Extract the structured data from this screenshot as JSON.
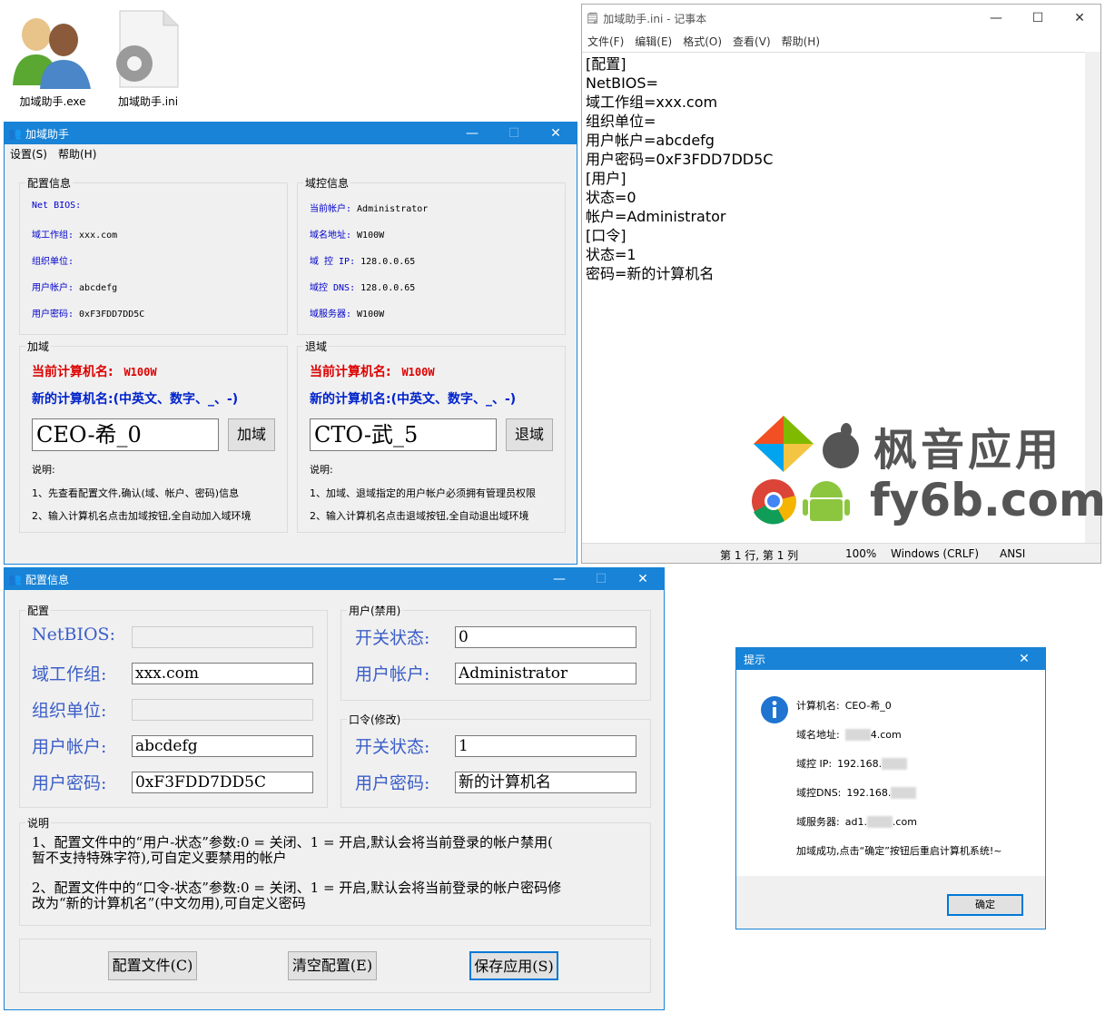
{
  "desktop": {
    "exe_label": "加域助手.exe",
    "ini_label": "加域助手.ini"
  },
  "main_win": {
    "title": "加域助手",
    "menus": [
      "设置(S)",
      "帮助(H)"
    ],
    "config_group": "配置信息",
    "config_rows": [
      {
        "k": "Net BIOS:",
        "v": ""
      },
      {
        "k": "域工作组:",
        "v": "xxx.com"
      },
      {
        "k": "组织单位:",
        "v": ""
      },
      {
        "k": "用户帐户:",
        "v": "abcdefg"
      },
      {
        "k": "用户密码:",
        "v": "0xF3FDD7DD5C"
      }
    ],
    "dc_group": "域控信息",
    "dc_rows": [
      {
        "k": "当前帐户:",
        "v": "Administrator"
      },
      {
        "k": "域名地址:",
        "v": "W100W"
      },
      {
        "k": "域 控 IP:",
        "v": "128.0.0.65"
      },
      {
        "k": "域控 DNS:",
        "v": "128.0.0.65"
      },
      {
        "k": "域服务器:",
        "v": "W100W"
      }
    ],
    "join_group": "加域",
    "leave_group": "退域",
    "current_name_label": "当前计算机名:",
    "current_name_value": "W100W",
    "new_name_label": "新的计算机名:(中英文、数字、_、-)",
    "join_input": "CEO-希_0",
    "leave_input": "CTO-武_5",
    "join_btn": "加域",
    "leave_btn": "退域",
    "desc_title": "说明:",
    "join_notes": [
      "1、先查看配置文件,确认(域、帐户、密码)信息",
      "2、输入计算机名点击加域按钮,全自动加入域环境"
    ],
    "leave_notes": [
      "1、加域、退域指定的用户帐户必须拥有管理员权限",
      "2、输入计算机名点击退域按钮,全自动退出域环境"
    ]
  },
  "notepad": {
    "title": "加域助手.ini - 记事本",
    "menus": [
      "文件(F)",
      "编辑(E)",
      "格式(O)",
      "查看(V)",
      "帮助(H)"
    ],
    "lines": [
      "[配置]",
      "NetBIOS=",
      "域工作组=xxx.com",
      "组织单位=",
      "用户帐户=abcdefg",
      "用户密码=0xF3FDD7DD5C",
      "[用户]",
      "状态=0",
      "帐户=Administrator",
      "[口令]",
      "状态=1",
      "密码=新的计算机名"
    ],
    "status_pos": "第 1 行, 第 1 列",
    "status_zoom": "100%",
    "status_eol": "Windows (CRLF)",
    "status_enc": "ANSI"
  },
  "watermark": {
    "cn": "枫音应用",
    "en": "fy6b.com"
  },
  "config_win": {
    "title": "配置信息",
    "cfg_group": "配置",
    "cfg_rows": [
      {
        "k": "NetBIOS:",
        "v": "",
        "disabled": true
      },
      {
        "k": "域工作组:",
        "v": "xxx.com",
        "disabled": false
      },
      {
        "k": "组织单位:",
        "v": "",
        "disabled": true
      },
      {
        "k": "用户帐户:",
        "v": "abcdefg",
        "disabled": false
      },
      {
        "k": "用户密码:",
        "v": "0xF3FDD7DD5C",
        "disabled": false
      }
    ],
    "user_group": "用户(禁用)",
    "user_rows": [
      {
        "k": "开关状态:",
        "v": "0"
      },
      {
        "k": "用户帐户:",
        "v": "Administrator"
      }
    ],
    "pwd_group": "口令(修改)",
    "pwd_rows": [
      {
        "k": "开关状态:",
        "v": "1"
      },
      {
        "k": "用户密码:",
        "v": "新的计算机名"
      }
    ],
    "desc_group": "说明",
    "desc_lines": [
      "1、配置文件中的“用户-状态”参数:0 = 关闭、1 = 开启,默认会将当前登录的帐户禁用(",
      "暂不支持特殊字符),可自定义要禁用的帐户",
      "2、配置文件中的“口令-状态”参数:0 = 关闭、1 = 开启,默认会将当前登录的帐户密码修",
      "改为“新的计算机名”(中文勿用),可自定义密码"
    ],
    "btn_cfg": "配置文件(C)",
    "btn_clear": "清空配置(E)",
    "btn_save": "保存应用(S)"
  },
  "dialog": {
    "title": "提示",
    "rows": [
      {
        "k": "计算机名:",
        "v": "CEO-希_0",
        "tail": ""
      },
      {
        "k": "域名地址:",
        "v": "",
        "tail": "4.com"
      },
      {
        "k": "域控 IP:",
        "v": "192.168.",
        "tail": ""
      },
      {
        "k": "域控DNS:",
        "v": "192.168.",
        "tail": ""
      },
      {
        "k": "域服务器:",
        "v": "ad1.",
        "tail": ".com"
      }
    ],
    "message": "加域成功,点击“确定”按钮后重启计算机系统!~",
    "ok": "确定"
  }
}
